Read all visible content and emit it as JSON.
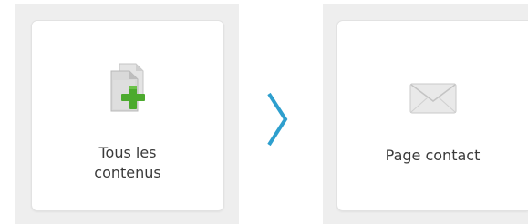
{
  "cards": [
    {
      "label_line1": "Tous les",
      "label_line2": "contenus",
      "icon": "add-document-icon"
    },
    {
      "label": "Page contact",
      "icon": "envelope-icon"
    }
  ],
  "separator": {
    "icon": "chevron-right-icon",
    "color": "#2e9fce"
  },
  "colors": {
    "panel_bg": "#eeeeee",
    "card_bg": "#ffffff",
    "plus_green": "#4caa2e"
  }
}
